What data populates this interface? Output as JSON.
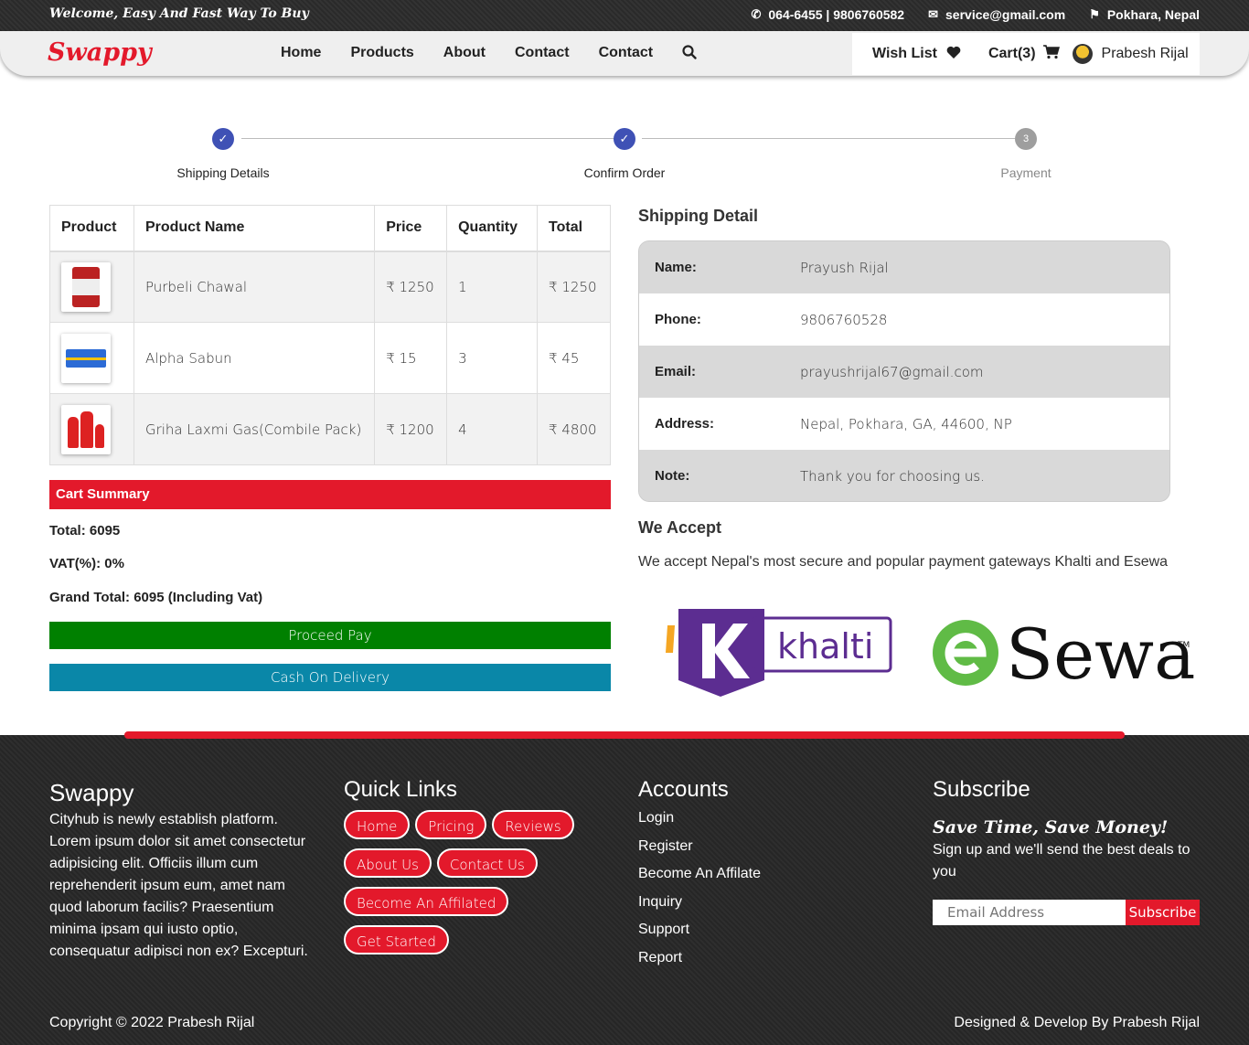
{
  "topbar": {
    "welcome": "Welcome, Easy And Fast Way To Buy",
    "phone": "064-6455 | 9806760582",
    "email": "service@gmail.com",
    "location": "Pokhara, Nepal"
  },
  "nav": {
    "brand": "Swappy",
    "menu": [
      "Home",
      "Products",
      "About",
      "Contact",
      "Contact"
    ],
    "wishlist": "Wish List",
    "cart": "Cart(3)",
    "user": "Prabesh Rijal"
  },
  "stepper": {
    "steps": [
      {
        "label": "Shipping Details",
        "state": "done"
      },
      {
        "label": "Confirm Order",
        "state": "done"
      },
      {
        "label": "Payment",
        "state": "pending",
        "number": "3"
      }
    ]
  },
  "table": {
    "headers": [
      "Product",
      "Product Name",
      "Price",
      "Quantity",
      "Total"
    ],
    "rows": [
      {
        "name": "Purbeli Chawal",
        "price": "₹ 1250",
        "qty": "1",
        "total": "₹ 1250"
      },
      {
        "name": "Alpha Sabun",
        "price": "₹ 15",
        "qty": "3",
        "total": "₹ 45"
      },
      {
        "name": "Griha Laxmi Gas(Combile Pack)",
        "price": "₹ 1200",
        "qty": "4",
        "total": "₹ 4800"
      }
    ]
  },
  "summary": {
    "title": "Cart Summary",
    "total": "Total: 6095",
    "vat": "VAT(%): 0%",
    "grand_total": "Grand Total: 6095 (Including Vat)",
    "proceed": "Proceed Pay",
    "cod": "Cash On Delivery"
  },
  "shipping": {
    "title": "Shipping Detail",
    "rows": [
      {
        "key": "Name:",
        "value": "Prayush Rijal"
      },
      {
        "key": "Phone:",
        "value": "9806760528"
      },
      {
        "key": "Email:",
        "value": "prayushrijal67@gmail.com"
      },
      {
        "key": "Address:",
        "value": "Nepal, Pokhara, GA, 44600, NP"
      },
      {
        "key": "Note:",
        "value": "Thank you for choosing us."
      }
    ]
  },
  "accept": {
    "title": "We Accept",
    "text": "We accept Nepal's most secure and popular payment gateways Khalti and Esewa",
    "khalti": "khalti",
    "esewa": "Sewa",
    "esewa_tm": "TM"
  },
  "footer": {
    "about_title": "Swappy",
    "about_text": "Cityhub is newly establish platform. Lorem ipsum dolor sit amet consectetur adipisicing elit. Officiis illum cum reprehenderit ipsum eum, amet nam quod laborum facilis? Praesentium minima ipsam qui iusto optio, consequatur adipisci non ex? Excepturi.",
    "links_title": "Quick Links",
    "links": [
      "Home",
      "Pricing",
      "Reviews",
      "About Us",
      "Contact Us",
      "Become An Affilated",
      "Get Started"
    ],
    "accounts_title": "Accounts",
    "accounts": [
      "Login",
      "Register",
      "Become An Affilate",
      "Inquiry",
      "Support",
      "Report"
    ],
    "subscribe_title": "Subscribe",
    "subscribe_tag": "Save Time, Save Money!",
    "subscribe_text": "Sign up and we'll send the best deals to you",
    "email_placeholder": "Email Address",
    "subscribe_button": "Subscribe",
    "copyright": "Copyright © 2022 Prabesh Rijal",
    "designed": "Designed & Develop By Prabesh Rijal"
  },
  "colors": {
    "accent": "#e3192b",
    "step_done": "#3f51b5",
    "proceed": "#008000",
    "cod": "#0a87a8"
  }
}
